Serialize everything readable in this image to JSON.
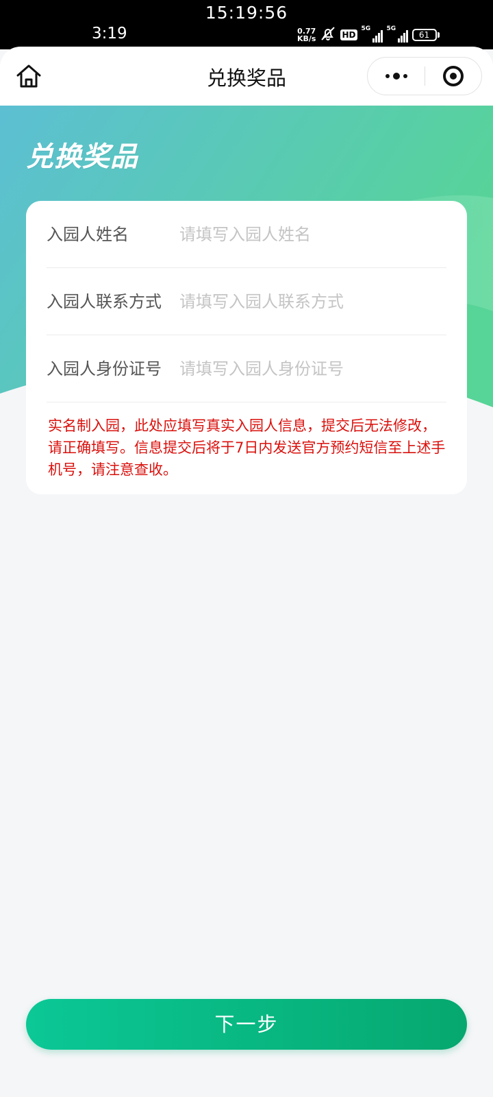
{
  "status_bar": {
    "overlay_time": "15:19:56",
    "clock": "3:19",
    "net_speed_value": "0.77",
    "net_speed_unit": "KB/s",
    "hd_badge": "HD",
    "signal_1_label": "5G",
    "signal_2_label": "5G",
    "battery_level": "61",
    "icons": [
      "mute-bell-icon",
      "signal-icon",
      "signal-icon",
      "battery-icon"
    ]
  },
  "navbar": {
    "title": "兑换奖品",
    "home_icon": "home-icon",
    "more_icon": "more-dots-icon",
    "close_icon": "target-close-icon"
  },
  "hero": {
    "title": "兑换奖品",
    "gradient_start": "#5cbfd3",
    "gradient_end": "#57d497"
  },
  "form": {
    "fields": [
      {
        "label": "入园人姓名",
        "placeholder": "请填写入园人姓名",
        "value": ""
      },
      {
        "label": "入园人联系方式",
        "placeholder": "请填写入园人联系方式",
        "value": ""
      },
      {
        "label": "入园人身份证号",
        "placeholder": "请填写入园人身份证号",
        "value": ""
      }
    ],
    "notice": "实名制入园，此处应填写真实入园人信息，提交后无法修改，请正确填写。信息提交后将于7日内发送官方预约短信至上述手机号，请注意查收。",
    "notice_color": "#d9100c"
  },
  "footer": {
    "next_label": "下一步",
    "button_color_start": "#0bc896",
    "button_color_end": "#06a86f"
  }
}
